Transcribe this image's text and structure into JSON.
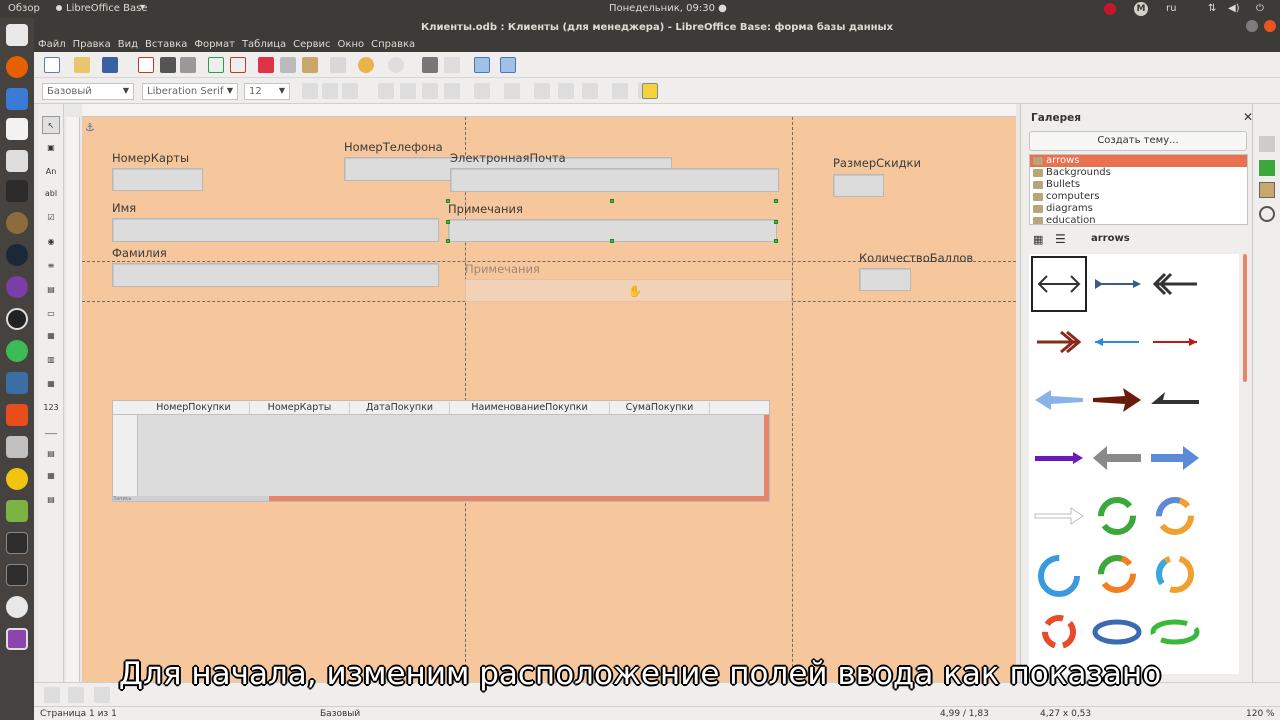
{
  "topbar": {
    "overview": "Обзор",
    "app_menu": "LibreOffice Base",
    "clock": "Понедельник, 09:30 ●",
    "lang": "ru",
    "avatar": "M"
  },
  "window": {
    "title": "Клиенты.odb : Клиенты (для менеджера) - LibreOffice Base: форма базы данных"
  },
  "menu": {
    "items": [
      "Файл",
      "Правка",
      "Вид",
      "Вставка",
      "Формат",
      "Таблица",
      "Сервис",
      "Окно",
      "Справка"
    ]
  },
  "formatting": {
    "style": "Базовый",
    "font": "Liberation Serif",
    "size": "12"
  },
  "form": {
    "labels": {
      "card": "НомерКарты",
      "phone": "НомерТелефона",
      "email": "ЭлектроннаяПочта",
      "discount": "РазмерСкидки",
      "first_name": "Имя",
      "notes": "Примечания",
      "last_name": "Фамилия",
      "notes_ghost": "Примечания",
      "points": "КоличествоБаллов"
    },
    "grid": {
      "columns": [
        "НомерПокупки",
        "НомерКарты",
        "ДатаПокупки",
        "НаименованиеПокупки",
        "СумаПокупки"
      ],
      "nav": "Запись"
    }
  },
  "gallery": {
    "title": "Галерея",
    "new_theme": "Создать тему...",
    "themes": [
      "arrows",
      "Backgrounds",
      "Bullets",
      "computers",
      "diagrams",
      "education"
    ],
    "selected_theme": "arrows",
    "current_view": "arrows"
  },
  "status": {
    "page": "Страница 1 из 1",
    "style": "Базовый",
    "position": "4,99 / 1,83",
    "size": "4,27 x 0,53",
    "zoom": "120 %"
  },
  "subtitle": "Для начала, изменим расположение полей ввода как показано",
  "colors": {
    "canvas": "#f6c69c",
    "accent": "#e9714f",
    "handle": "#3fbf3f"
  }
}
